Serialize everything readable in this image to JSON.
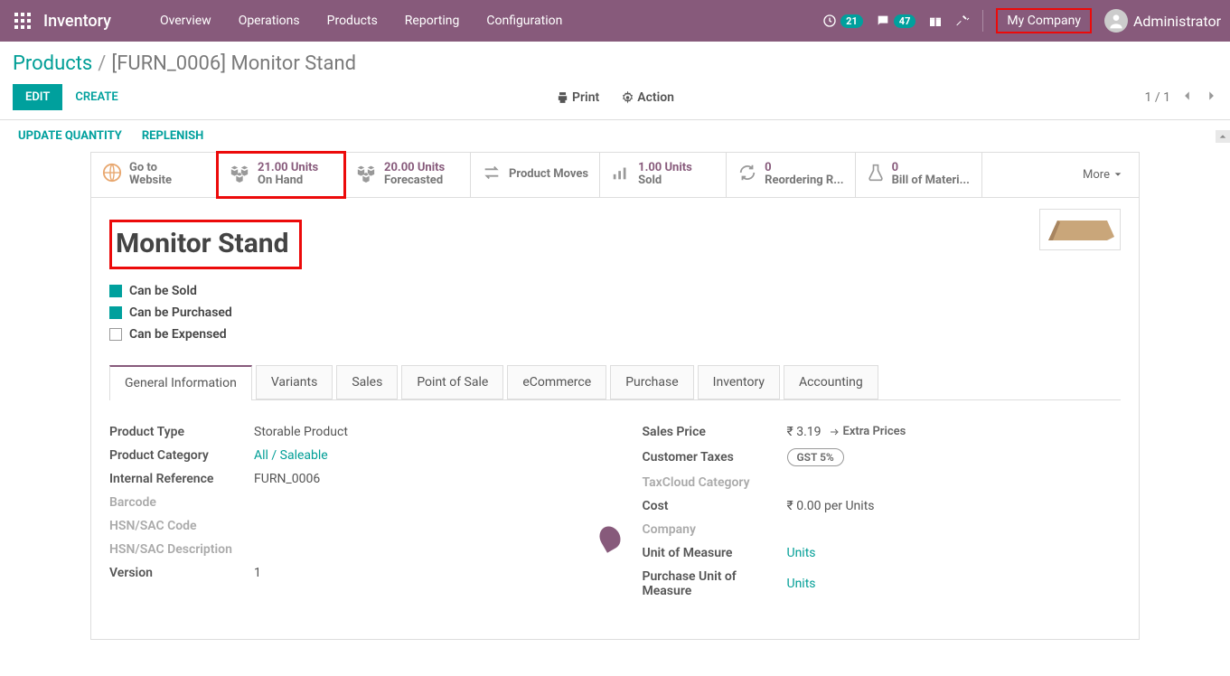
{
  "topbar": {
    "app_title": "Inventory",
    "nav": [
      "Overview",
      "Operations",
      "Products",
      "Reporting",
      "Configuration"
    ],
    "clock_badge": "21",
    "chat_badge": "47",
    "company": "My Company",
    "user": "Administrator"
  },
  "breadcrumb": {
    "root": "Products",
    "current": "[FURN_0006] Monitor Stand"
  },
  "controls": {
    "edit": "EDIT",
    "create": "CREATE",
    "print": "Print",
    "action": "Action",
    "pager": "1 / 1"
  },
  "status_links": [
    "UPDATE QUANTITY",
    "REPLENISH"
  ],
  "stats": [
    {
      "value": "",
      "label1": "Go to",
      "label2": "Website"
    },
    {
      "value": "21.00 Units",
      "label2": "On Hand"
    },
    {
      "value": "20.00 Units",
      "label2": "Forecasted"
    },
    {
      "value": "",
      "label2": "Product Moves"
    },
    {
      "value": "1.00 Units",
      "label2": "Sold"
    },
    {
      "value": "0",
      "label2": "Reordering R..."
    },
    {
      "value": "0",
      "label2": "Bill of Materi..."
    }
  ],
  "more_label": "More",
  "product": {
    "name": "Monitor Stand",
    "can_sold": "Can be Sold",
    "can_purchased": "Can be Purchased",
    "can_expensed": "Can be Expensed"
  },
  "tabs": [
    "General Information",
    "Variants",
    "Sales",
    "Point of Sale",
    "eCommerce",
    "Purchase",
    "Inventory",
    "Accounting"
  ],
  "left_fields": {
    "product_type_lbl": "Product Type",
    "product_type_val": "Storable Product",
    "product_cat_lbl": "Product Category",
    "product_cat_val": "All / Saleable",
    "internal_ref_lbl": "Internal Reference",
    "internal_ref_val": "FURN_0006",
    "barcode_lbl": "Barcode",
    "hsn_lbl": "HSN/SAC Code",
    "hsn_desc_lbl": "HSN/SAC Description",
    "version_lbl": "Version",
    "version_val": "1"
  },
  "right_fields": {
    "sales_price_lbl": "Sales Price",
    "sales_price_val": "₹ 3.19",
    "extra_prices": "Extra Prices",
    "cust_tax_lbl": "Customer Taxes",
    "cust_tax_val": "GST 5%",
    "taxcloud_lbl": "TaxCloud Category",
    "cost_lbl": "Cost",
    "cost_val": "₹ 0.00  per Units",
    "company_lbl": "Company",
    "uom_lbl": "Unit of Measure",
    "uom_val": "Units",
    "puom_lbl": "Purchase Unit of Measure",
    "puom_val": "Units"
  }
}
